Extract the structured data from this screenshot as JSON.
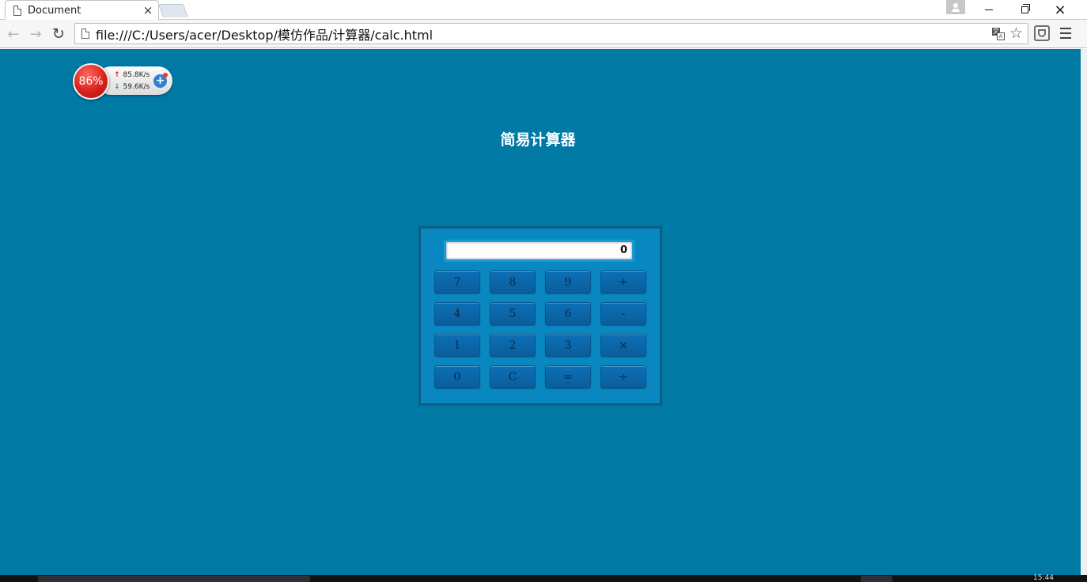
{
  "browser": {
    "tab_title": "Document",
    "tab_close": "×",
    "url": "file:///C:/Users/acer/Desktop/模仿作品/计算器/calc.html",
    "translate_icon_a": "文",
    "translate_icon_b": "A",
    "window_close": "×"
  },
  "net_widget": {
    "percent": "86%",
    "up_speed": "85.8K/s",
    "down_speed": "59.6K/s",
    "up_arrow": "↑",
    "down_arrow": "↓",
    "boost": "+"
  },
  "page": {
    "title": "简易计算器"
  },
  "calculator": {
    "display_value": "0",
    "keys": [
      "7",
      "8",
      "9",
      "+",
      "4",
      "5",
      "6",
      "-",
      "1",
      "2",
      "3",
      "×",
      "0",
      "C",
      "=",
      "÷"
    ]
  },
  "taskbar": {
    "clock": "15:44"
  },
  "colors": {
    "page_background": "#0079a5",
    "calculator_body": "#0987c1",
    "calculator_border": "#0d5e82",
    "key_gradient_top": "#0c6fb5",
    "key_gradient_bottom": "#0a5e9c"
  }
}
